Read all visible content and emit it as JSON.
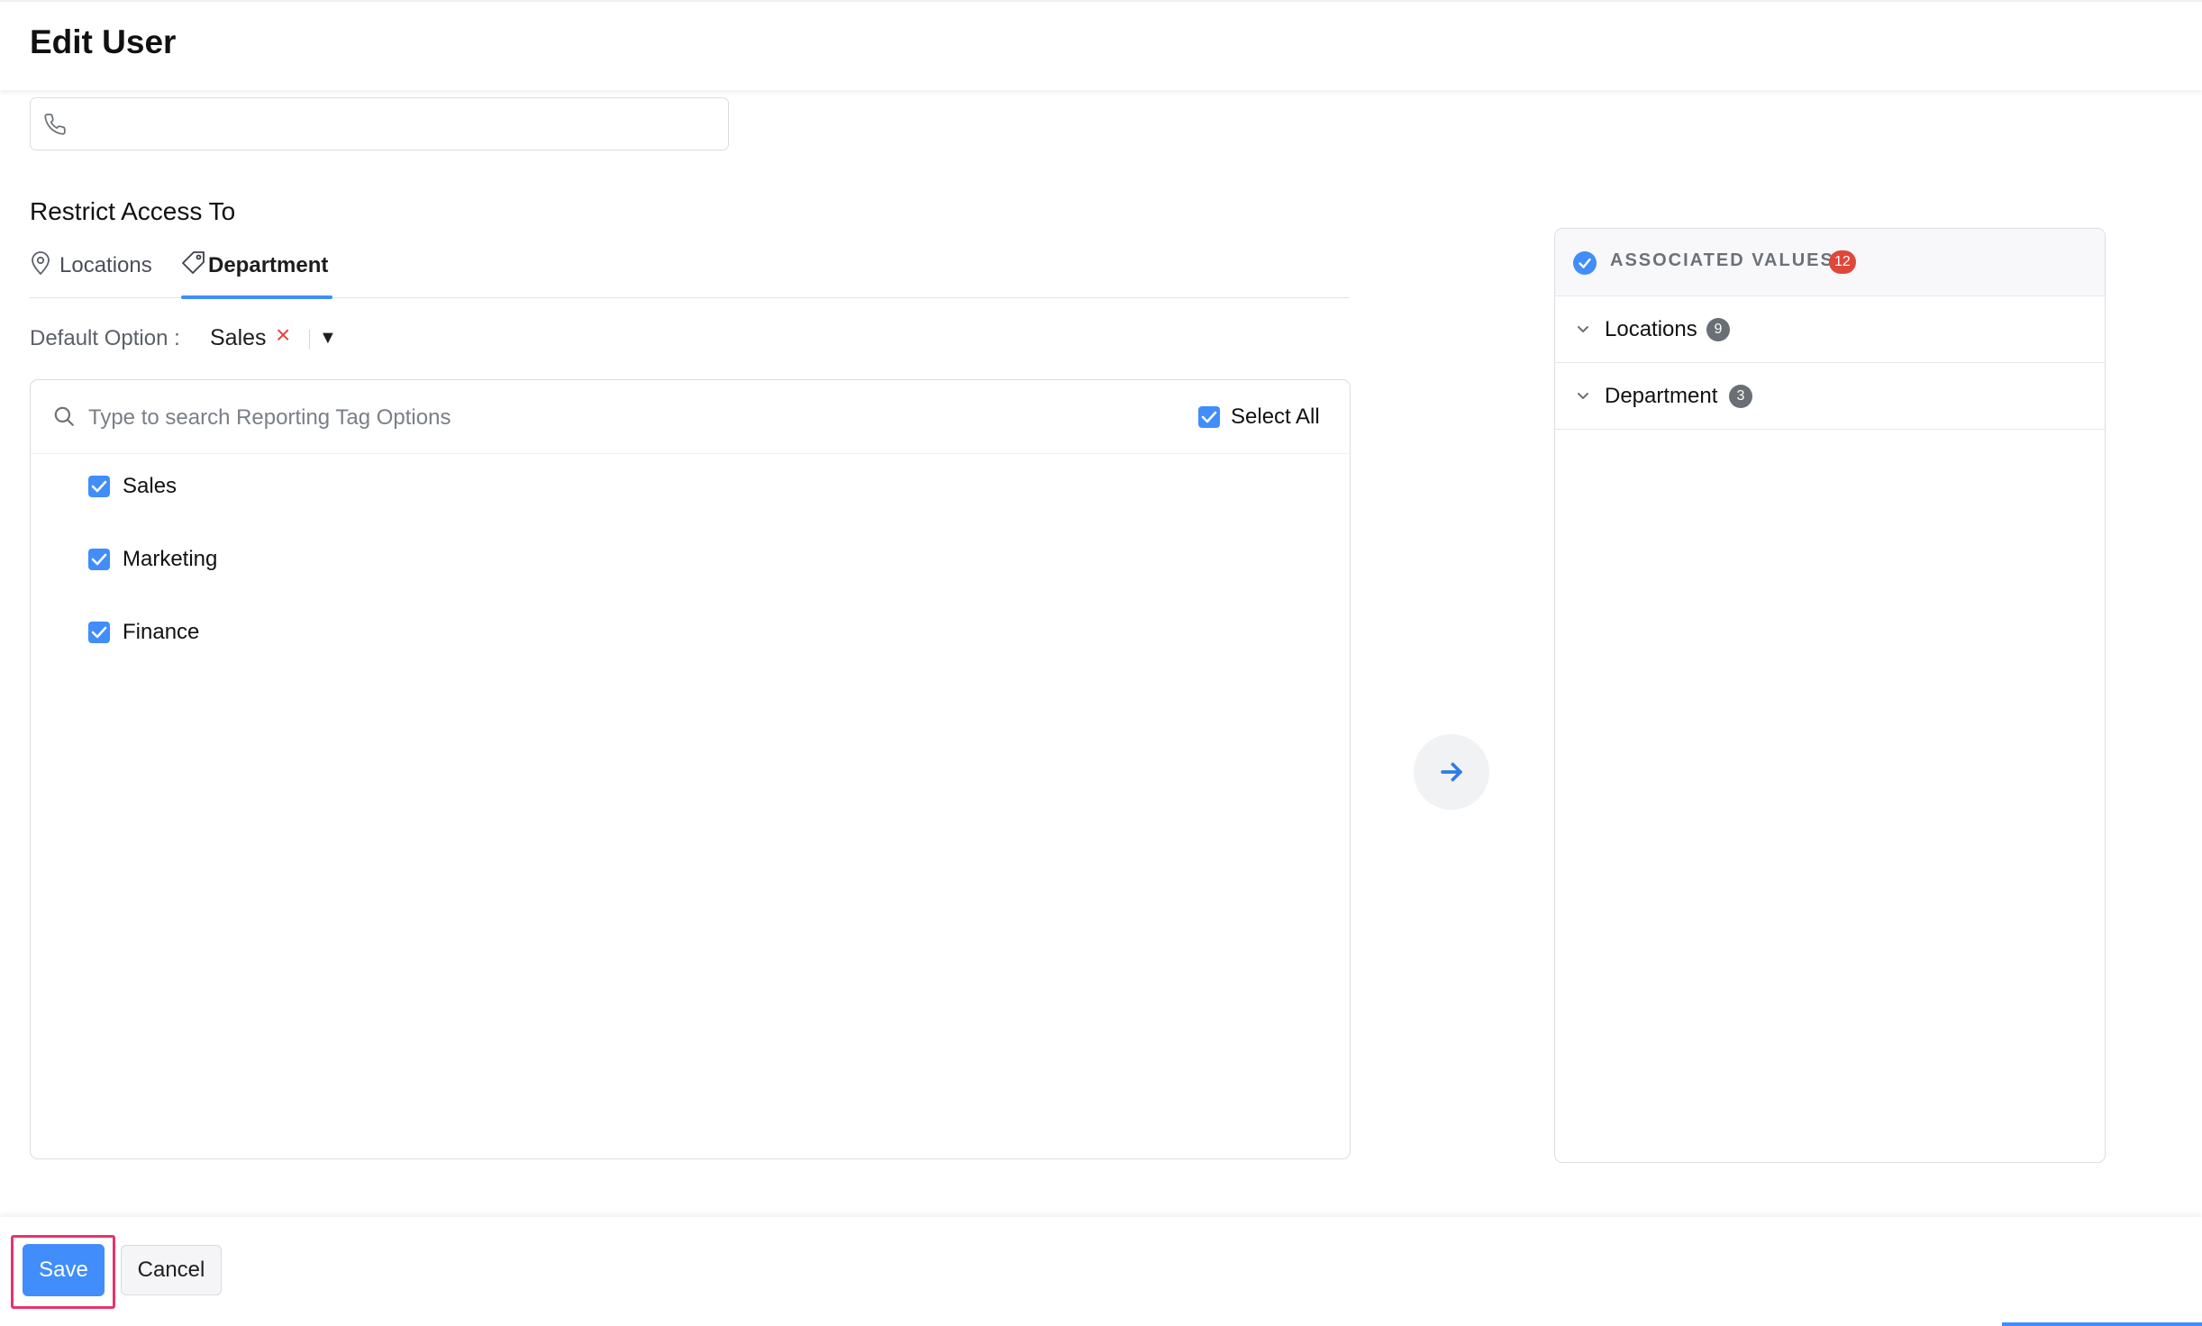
{
  "header": {
    "title": "Edit User"
  },
  "phone": {
    "value": "",
    "icon": "phone-icon"
  },
  "restrict": {
    "title": "Restrict Access To",
    "tabs": [
      {
        "label": "Locations",
        "icon": "location-pin-icon",
        "active": false
      },
      {
        "label": "Department",
        "icon": "tag-icon",
        "active": true
      }
    ]
  },
  "default_option": {
    "label": "Default Option :",
    "value": "Sales",
    "remove_icon": "×",
    "dropdown_icon": "▼"
  },
  "options_panel": {
    "search_placeholder": "Type to search Reporting Tag Options",
    "select_all_label": "Select All",
    "select_all_checked": true,
    "options": [
      {
        "label": "Sales",
        "checked": true
      },
      {
        "label": "Marketing",
        "checked": true
      },
      {
        "label": "Finance",
        "checked": true
      }
    ]
  },
  "transfer_button": {
    "icon": "arrow-right-icon"
  },
  "associated": {
    "title": "ASSOCIATED VALUES",
    "count": "12",
    "groups": [
      {
        "label": "Locations",
        "count": "9"
      },
      {
        "label": "Department",
        "count": "3"
      }
    ]
  },
  "footer": {
    "save_label": "Save",
    "cancel_label": "Cancel"
  },
  "colors": {
    "accent": "#408dfb",
    "danger": "#e0463a",
    "highlight": "#e8336a",
    "badge_gray": "#6a6e75"
  }
}
